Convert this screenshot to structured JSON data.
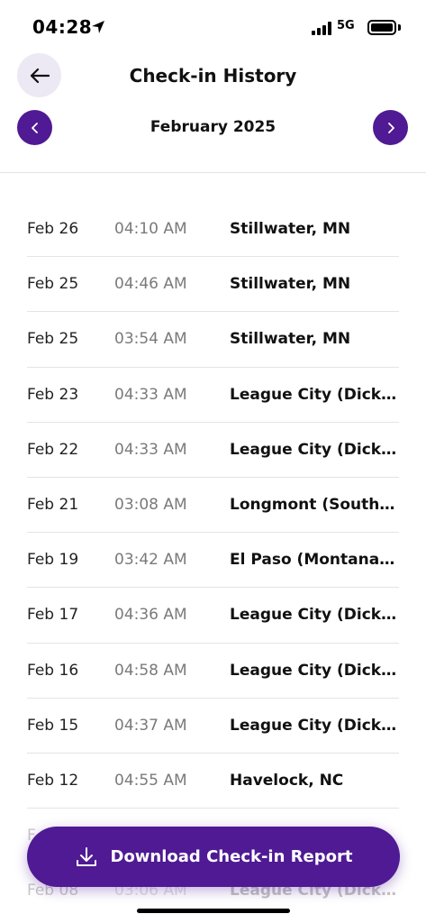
{
  "status_bar": {
    "time": "04:28",
    "network": "5G",
    "location_icon": "location-arrow-icon",
    "signal_icon": "signal-bars-icon",
    "battery_icon": "battery-icon"
  },
  "header": {
    "title": "Check-in History",
    "back_icon": "arrow-left-icon"
  },
  "month_nav": {
    "label": "February 2025",
    "prev_icon": "chevron-left-icon",
    "next_icon": "chevron-right-icon"
  },
  "checkins": [
    {
      "date": "Feb 26",
      "time": "04:10 AM",
      "location": "Stillwater, MN"
    },
    {
      "date": "Feb 25",
      "time": "04:46 AM",
      "location": "Stillwater, MN"
    },
    {
      "date": "Feb 25",
      "time": "03:54 AM",
      "location": "Stillwater, MN"
    },
    {
      "date": "Feb 23",
      "time": "04:33 AM",
      "location": "League City (Dickin..."
    },
    {
      "date": "Feb 22",
      "time": "04:33 AM",
      "location": "League City (Dickin..."
    },
    {
      "date": "Feb 21",
      "time": "03:08 AM",
      "location": "Longmont (South),..."
    },
    {
      "date": "Feb 19",
      "time": "03:42 AM",
      "location": "El Paso (Montana), TX"
    },
    {
      "date": "Feb 17",
      "time": "04:36 AM",
      "location": "League City (Dickin..."
    },
    {
      "date": "Feb 16",
      "time": "04:58 AM",
      "location": "League City (Dickin..."
    },
    {
      "date": "Feb 15",
      "time": "04:37 AM",
      "location": "League City (Dickin..."
    },
    {
      "date": "Feb 12",
      "time": "04:55 AM",
      "location": "Havelock, NC"
    }
  ],
  "partial_rows": [
    {
      "date": "F",
      "time": "",
      "location": ""
    },
    {
      "date": "Feb 08",
      "time": "03:06 AM",
      "location": "League City (Dickin..."
    }
  ],
  "cta": {
    "label": "Download Check-in Report",
    "icon": "download-icon"
  },
  "colors": {
    "accent": "#4f1a94",
    "back_button_bg": "#ece9f4",
    "muted_text": "#7a7a7a"
  }
}
